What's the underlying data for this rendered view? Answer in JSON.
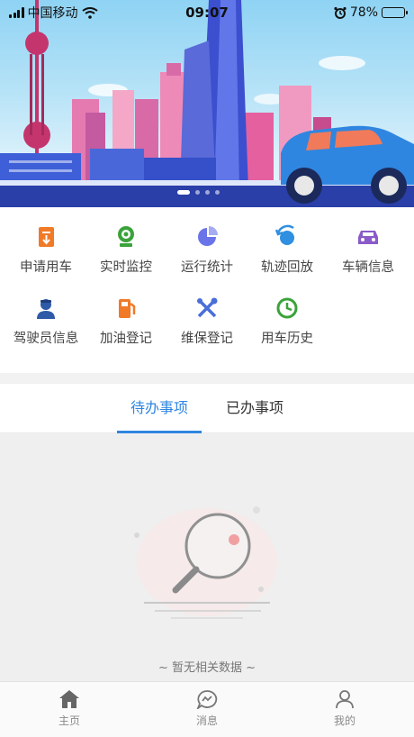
{
  "status_bar": {
    "carrier": "中国移动",
    "time": "09:07",
    "battery": "78%",
    "battery_level": 0.78,
    "icons": [
      "signal-icon",
      "wifi-icon",
      "alarm-icon",
      "battery-icon"
    ]
  },
  "banner": {
    "carousel_index": 1,
    "carousel_count": 4
  },
  "menu": [
    {
      "label": "申请用车",
      "icon": "car-apply-icon",
      "color": "#f07a28"
    },
    {
      "label": "实时监控",
      "icon": "camera-icon",
      "color": "#3aa33a"
    },
    {
      "label": "运行统计",
      "icon": "pie-chart-icon",
      "color": "#6a74e8"
    },
    {
      "label": "轨迹回放",
      "icon": "replay-icon",
      "color": "#2f8fe0"
    },
    {
      "label": "车辆信息",
      "icon": "vehicle-info-icon",
      "color": "#8a5bc9"
    },
    {
      "label": "驾驶员信息",
      "icon": "driver-icon",
      "color": "#2e5aa8"
    },
    {
      "label": "加油登记",
      "icon": "fuel-icon",
      "color": "#f07a28"
    },
    {
      "label": "维保登记",
      "icon": "tools-icon",
      "color": "#4a6fd8"
    },
    {
      "label": "用车历史",
      "icon": "history-icon",
      "color": "#3aa33a"
    }
  ],
  "tabs": [
    {
      "label": "待办事项",
      "active": true
    },
    {
      "label": "已办事项",
      "active": false
    }
  ],
  "empty_state": {
    "text": "~ 暂无相关数据 ~",
    "icon": "magnifier-icon"
  },
  "bottom_nav": [
    {
      "label": "主页",
      "icon": "home-icon"
    },
    {
      "label": "消息",
      "icon": "message-icon"
    },
    {
      "label": "我的",
      "icon": "profile-icon"
    }
  ],
  "colors": {
    "accent": "#2f86e0",
    "text": "#444444",
    "muted": "#8a8a8a",
    "divider": "#efefef"
  }
}
